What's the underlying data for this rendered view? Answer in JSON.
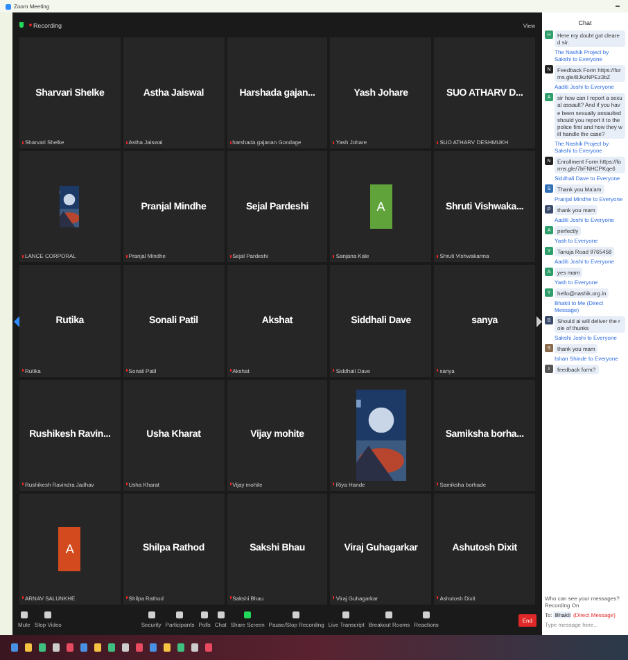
{
  "window": {
    "title": "Zoom Meeting"
  },
  "meeting_bar": {
    "status": "Recording",
    "view": "View"
  },
  "tiles": [
    {
      "kind": "name",
      "name": "Sharvari Shelke",
      "label": "Sharvari Shelke"
    },
    {
      "kind": "name",
      "name": "Astha Jaiswal",
      "label": "Astha Jaiswal"
    },
    {
      "kind": "name",
      "name": "Harshada gajan...",
      "label": "harshada gajanan Gondage"
    },
    {
      "kind": "name",
      "name": "Yash Johare",
      "label": "Yash Johare"
    },
    {
      "kind": "name",
      "name": "SUO ATHARV D...",
      "label": "SUO ATHARV DESHMUKH"
    },
    {
      "kind": "picture",
      "label": "LANCE CORPORAL"
    },
    {
      "kind": "name",
      "name": "Pranjal Mindhe",
      "label": "Pranjal Mindhe"
    },
    {
      "kind": "name",
      "name": "Sejal Pardeshi",
      "label": "Sejal Pardeshi"
    },
    {
      "kind": "avatar",
      "initial": "A",
      "color": "#5fa33a",
      "label": "Sanjana Kale"
    },
    {
      "kind": "name",
      "name": "Shruti Vishwaka...",
      "label": "Shruti Vishwakarma"
    },
    {
      "kind": "name",
      "name": "Rutika",
      "label": "Rutika"
    },
    {
      "kind": "name",
      "name": "Sonali Patil",
      "label": "Sonali Patil"
    },
    {
      "kind": "name",
      "name": "Akshat",
      "label": "Akshat"
    },
    {
      "kind": "name",
      "name": "Siddhali Dave",
      "label": "Siddhali Dave"
    },
    {
      "kind": "name",
      "name": "sanya",
      "label": "sanya"
    },
    {
      "kind": "name",
      "name": "Rushikesh Ravin...",
      "label": "Rushikesh Ravindra Jadhav"
    },
    {
      "kind": "name",
      "name": "Usha Kharat",
      "label": "Usha Kharat"
    },
    {
      "kind": "name",
      "name": "Vijay mohite",
      "label": "Vijay mohite"
    },
    {
      "kind": "picture",
      "label": "Riya Hande"
    },
    {
      "kind": "name",
      "name": "Samiksha borha...",
      "label": "Samiksha borhade"
    },
    {
      "kind": "avatar",
      "initial": "A",
      "color": "#d24a1d",
      "label": "ARNAV SALUNKHE"
    },
    {
      "kind": "name",
      "name": "Shilpa Rathod",
      "label": "Shilpa Rathod"
    },
    {
      "kind": "name",
      "name": "Sakshi Bhau",
      "label": "Sakshi Bhau"
    },
    {
      "kind": "name",
      "name": "Viraj Guhagarkar",
      "label": "Viraj Guhagarkar"
    },
    {
      "kind": "name",
      "name": "Ashutosh Dixit",
      "label": "Ashutosh Dixit"
    }
  ],
  "toolbar": {
    "left": [
      "Mute",
      "Stop Video"
    ],
    "center": [
      "Security",
      "Participants",
      "Polls",
      "Chat",
      "Share Screen",
      "Pause/Stop Recording",
      "Live Transcript",
      "Breakout Rooms",
      "Reactions"
    ],
    "end": "End"
  },
  "chat": {
    "title": "Chat",
    "messages": [
      {
        "text": "Here my doubt got cleared sir.",
        "initial": "H",
        "color": "#2e9e6a"
      },
      {
        "sender": "The Nashik Project by Sakshi to Everyone",
        "text": "Feedback Form https://forms.gle/8JkzNPEz3bZ",
        "initial": "N",
        "color": "#222222"
      },
      {
        "sender": "Aaditi Joshi to Everyone",
        "text": "sir how can I report a sexual assault? And if you have been sexually assaulted should you report it to the police first and how they will handle the case?",
        "initial": "A",
        "color": "#2e9e6a"
      },
      {
        "sender": "The Nashik Project by Sakshi to Everyone",
        "text": "Enrollment Form https://forms.gle/7bFNHCPKqe6",
        "initial": "N",
        "color": "#222222"
      },
      {
        "sender": "Siddhali Dave to Everyone",
        "text": "Thank you Ma'am",
        "initial": "S",
        "color": "#2f6fb5"
      },
      {
        "sender": "Pranjal Mindhe to Everyone",
        "text": "thank you mam",
        "initial": "P",
        "color": "#3a4a6a"
      },
      {
        "sender": "Aaditi Joshi to Everyone",
        "text": "perfectly",
        "initial": "A",
        "color": "#2e9e6a"
      },
      {
        "sender": "Yash to Everyone",
        "text": "Tanuja Road 9765458",
        "initial": "Y",
        "color": "#2e9e6a"
      },
      {
        "sender": "Aaditi Joshi to Everyone",
        "text": "yes mam",
        "initial": "A",
        "color": "#2e9e6a"
      },
      {
        "sender": "Yash to Everyone",
        "text": "hello@nashik.org.in",
        "initial": "Y",
        "color": "#2e9e6a"
      },
      {
        "sender": "Bhakti to Me (Direct Message)",
        "text": "Should ai will deliver the role of thunks",
        "initial": "B",
        "color": "#3a4a6a"
      },
      {
        "sender": "Sakshi Joshi to Everyone",
        "text": "thank you mam",
        "initial": "S",
        "color": "#8a6a4a"
      },
      {
        "sender": "Ishan Shinde to Everyone",
        "text": "feedback form?",
        "initial": "I",
        "color": "#555555"
      }
    ],
    "notice": "Who can see your messages? Recording On",
    "to_label": "To:",
    "to_value": "Bhakti",
    "to_note": "(Direct Message)",
    "placeholder": "Type message here..."
  }
}
